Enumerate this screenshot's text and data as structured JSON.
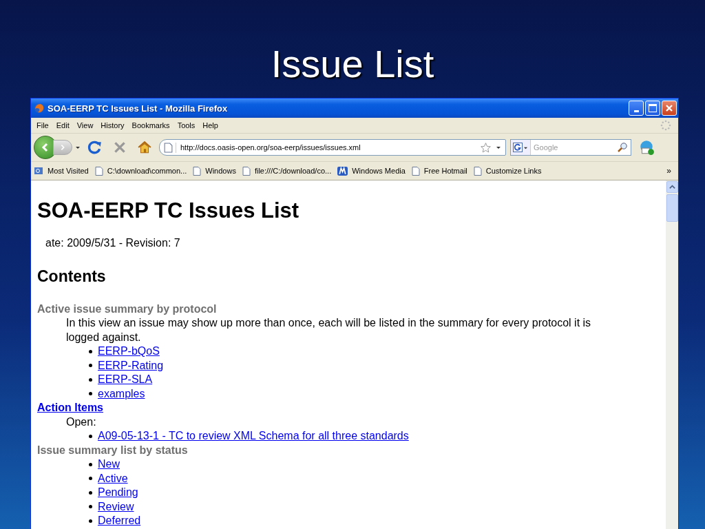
{
  "slide": {
    "title": "Issue List"
  },
  "window": {
    "title": "SOA-EERP TC Issues List - Mozilla Firefox"
  },
  "menu": [
    {
      "label": "File"
    },
    {
      "label": "Edit"
    },
    {
      "label": "View"
    },
    {
      "label": "History"
    },
    {
      "label": "Bookmarks"
    },
    {
      "label": "Tools"
    },
    {
      "label": "Help"
    }
  ],
  "address": {
    "value": "http://docs.oasis-open.org/soa-eerp/issues/issues.xml"
  },
  "search": {
    "placeholder": "Google"
  },
  "bookmarks": [
    {
      "label": "Most Visited",
      "kind": "folder"
    },
    {
      "label": "C:\\download\\common...",
      "kind": "page"
    },
    {
      "label": "Windows",
      "kind": "page"
    },
    {
      "label": "file:///C:/download/co...",
      "kind": "page"
    },
    {
      "label": "Windows Media",
      "kind": "media"
    },
    {
      "label": "Free Hotmail",
      "kind": "page"
    },
    {
      "label": "Customize Links",
      "kind": "page"
    }
  ],
  "bookmarks_overflow": "»",
  "page": {
    "title": "SOA-EERP TC Issues List",
    "meta": "ate: 2009/5/31 - Revision: 7",
    "contents_heading": "Contents",
    "sections": [
      {
        "kind": "heading",
        "text": "Active issue summary by protocol"
      },
      {
        "kind": "note",
        "text": "In this view an issue may show up more than once, each will be listed in the summary for every protocol it is logged against."
      },
      {
        "kind": "links",
        "items": [
          "EERP-bQoS",
          "EERP-Rating",
          "EERP-SLA",
          "examples"
        ]
      },
      {
        "kind": "link_heading",
        "text": "Action Items"
      },
      {
        "kind": "note",
        "text": "Open:"
      },
      {
        "kind": "links",
        "items": [
          "A09-05-13-1 - TC to review XML Schema for all three standards"
        ]
      },
      {
        "kind": "heading",
        "text": "Issue summary list by status"
      },
      {
        "kind": "links",
        "items": [
          "New",
          "Active",
          "Pending",
          "Review",
          "Deferred"
        ]
      }
    ]
  }
}
